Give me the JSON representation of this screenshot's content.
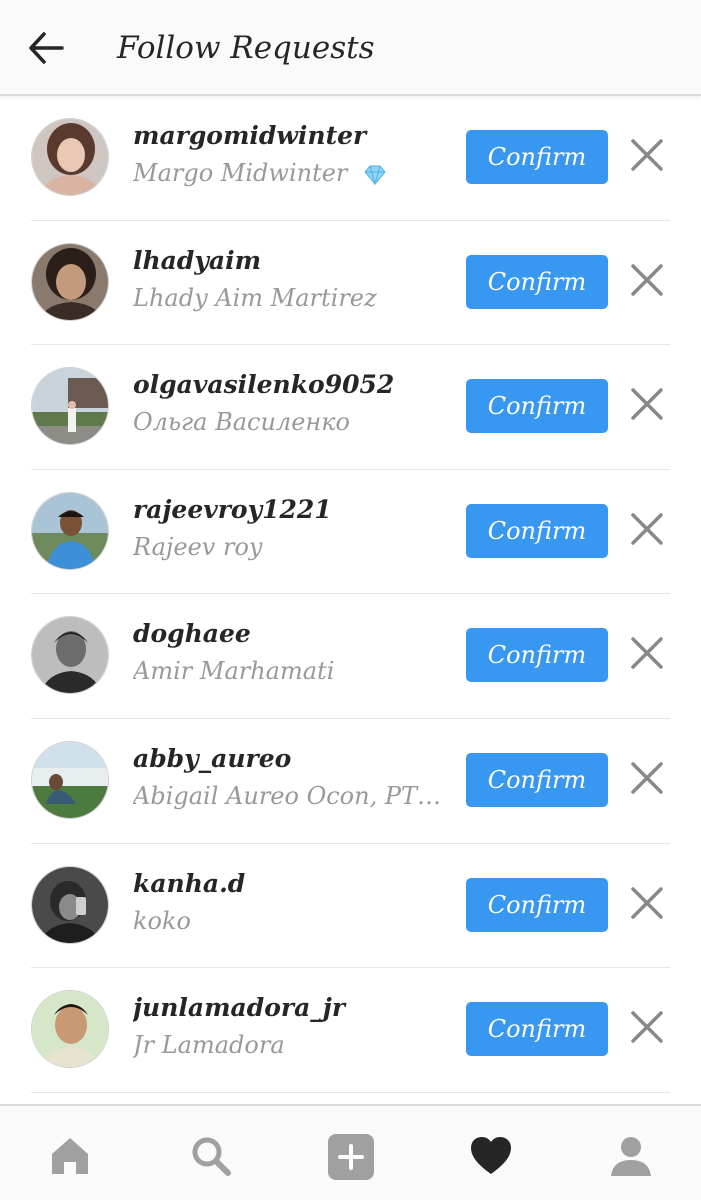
{
  "header": {
    "title": "Follow Requests",
    "back_icon": "arrow-left-icon"
  },
  "requests": [
    {
      "username": "margomidwinter",
      "full_name": "Margo Midwinter",
      "verified_badge": "diamond-icon",
      "confirm_label": "Confirm"
    },
    {
      "username": "lhadyaim",
      "full_name": "Lhady Aim Martirez",
      "confirm_label": "Confirm"
    },
    {
      "username": "olgavasilenko9052",
      "full_name": "Ольга Василенко",
      "confirm_label": "Confirm"
    },
    {
      "username": "rajeevroy1221",
      "full_name": "Rajeev roy",
      "confirm_label": "Confirm"
    },
    {
      "username": "doghaee",
      "full_name": "Amir Marhamati",
      "confirm_label": "Confirm"
    },
    {
      "username": "abby_aureo",
      "full_name": "Abigail Aureo Ocon, PTR...",
      "confirm_label": "Confirm"
    },
    {
      "username": "kanha.d",
      "full_name": "koko",
      "confirm_label": "Confirm"
    },
    {
      "username": "junlamadora_jr",
      "full_name": "Jr Lamadora",
      "confirm_label": "Confirm"
    }
  ],
  "tabbar": {
    "items": [
      "home-icon",
      "search-icon",
      "add-post-icon",
      "activity-heart-icon",
      "profile-icon"
    ],
    "active": "activity-heart-icon"
  },
  "colors": {
    "accent": "#3897f0",
    "text_primary": "#262626",
    "text_secondary": "#999999",
    "icon_inactive": "#a0a0a0"
  }
}
